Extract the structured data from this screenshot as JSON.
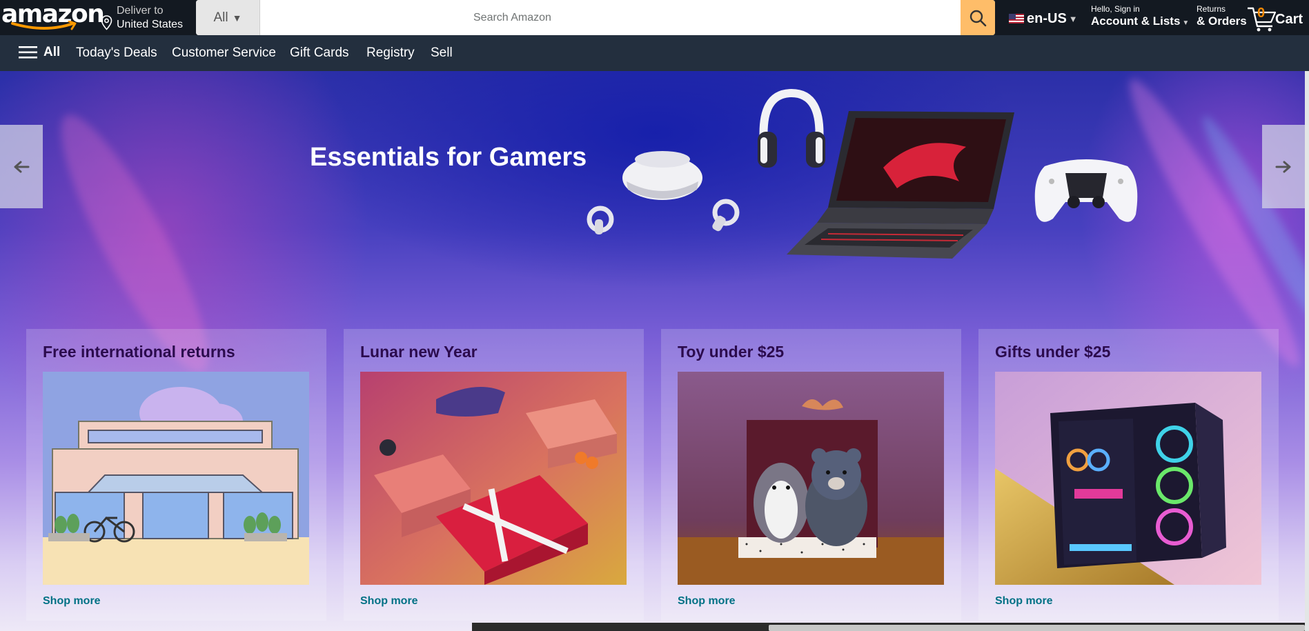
{
  "header": {
    "logo_text": "amazon",
    "deliver_line1": "Deliver to",
    "deliver_line2": "United States",
    "search": {
      "category": "All",
      "placeholder": "Search Amazon",
      "value": ""
    },
    "language": "en-US",
    "account_line1": "Hello, Sign in",
    "account_line2": "Account & Lists",
    "orders_line1": "Returns",
    "orders_line2": "& Orders",
    "cart_count": "0",
    "cart_label": "Cart"
  },
  "nav": {
    "all_label": "All",
    "links": [
      "Today's Deals",
      "Customer Service",
      "Gift Cards",
      "Registry",
      "Sell"
    ]
  },
  "hero": {
    "title": "Essentials for Gamers"
  },
  "cards": [
    {
      "title": "Free international returns",
      "link": "Shop more"
    },
    {
      "title": "Lunar new Year",
      "link": "Shop more"
    },
    {
      "title": "Toy under $25",
      "link": "Shop more"
    },
    {
      "title": "Gifts under $25",
      "link": "Shop more"
    }
  ],
  "colors": {
    "nav_top": "#131921",
    "nav_bottom": "#232f3e",
    "search_button": "#febd69",
    "cart_count": "#f08804",
    "link": "#007185",
    "card_title": "#2b0b4d"
  }
}
